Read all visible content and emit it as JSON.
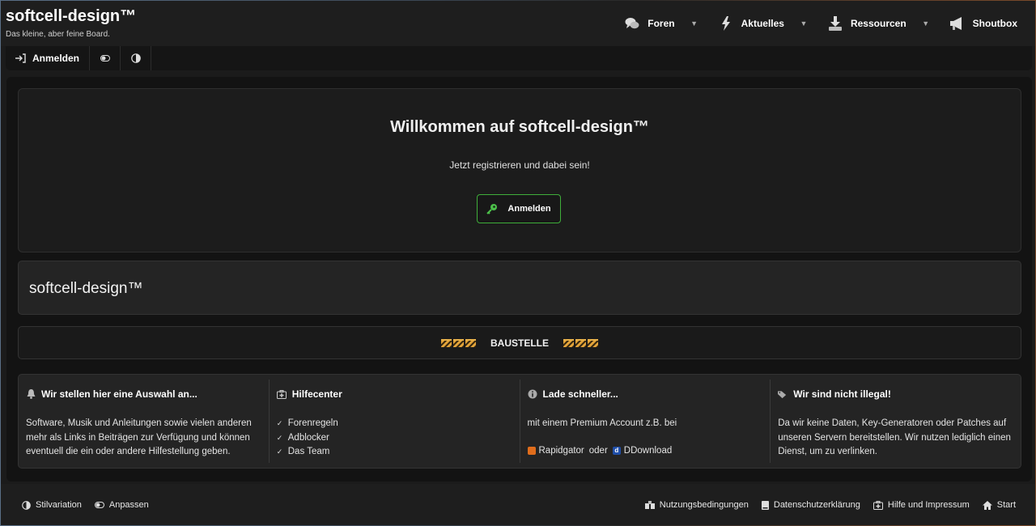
{
  "header": {
    "title": "softcell-design™",
    "subtitle": "Das kleine, aber feine Board.",
    "nav": [
      {
        "label": "Foren",
        "icon": "chat-bubbles-icon"
      },
      {
        "label": "Aktuelles",
        "icon": "lightning-icon"
      },
      {
        "label": "Ressourcen",
        "icon": "download-icon"
      },
      {
        "label": "Shoutbox",
        "icon": "megaphone-icon"
      }
    ]
  },
  "subbar": {
    "login_label": "Anmelden",
    "icons": [
      "toggle-icon",
      "contrast-icon"
    ]
  },
  "welcome": {
    "heading": "Willkommen auf softcell-design™",
    "lead": "Jetzt registrieren und dabei sein!",
    "button_label": "Anmelden"
  },
  "site_box": {
    "title": "softcell-design™"
  },
  "notice": {
    "label": "BAUSTELLE"
  },
  "info": {
    "col1": {
      "title": "Wir stellen hier eine Auswahl an...",
      "text": "Software, Musik und Anleitungen sowie vielen anderen mehr als Links in Beiträgen zur Verfügung und können eventuell die ein oder andere Hilfestellung geben."
    },
    "col2": {
      "title": "Hilfecenter",
      "items": [
        "Forenregeln",
        "Adblocker",
        "Das Team"
      ]
    },
    "col3": {
      "title": "Lade schneller...",
      "text": "mit einem Premium Account z.B. bei",
      "host1": "Rapidgator",
      "or": "oder",
      "host2": "DDownload"
    },
    "col4": {
      "title": "Wir sind nicht illegal!",
      "text": "Da wir keine Daten, Key-Generatoren oder Patches auf unseren Servern bereitstellen. Wir nutzen lediglich einen Dienst, um zu verlinken."
    }
  },
  "footer": {
    "left": [
      "Stilvariation",
      "Anpassen"
    ],
    "right": [
      "Nutzungsbedingungen",
      "Datenschutzerklärung",
      "Hilfe und Impressum",
      "Start"
    ]
  },
  "colors": {
    "accent_green": "#3fae3a",
    "background": "#131313"
  }
}
